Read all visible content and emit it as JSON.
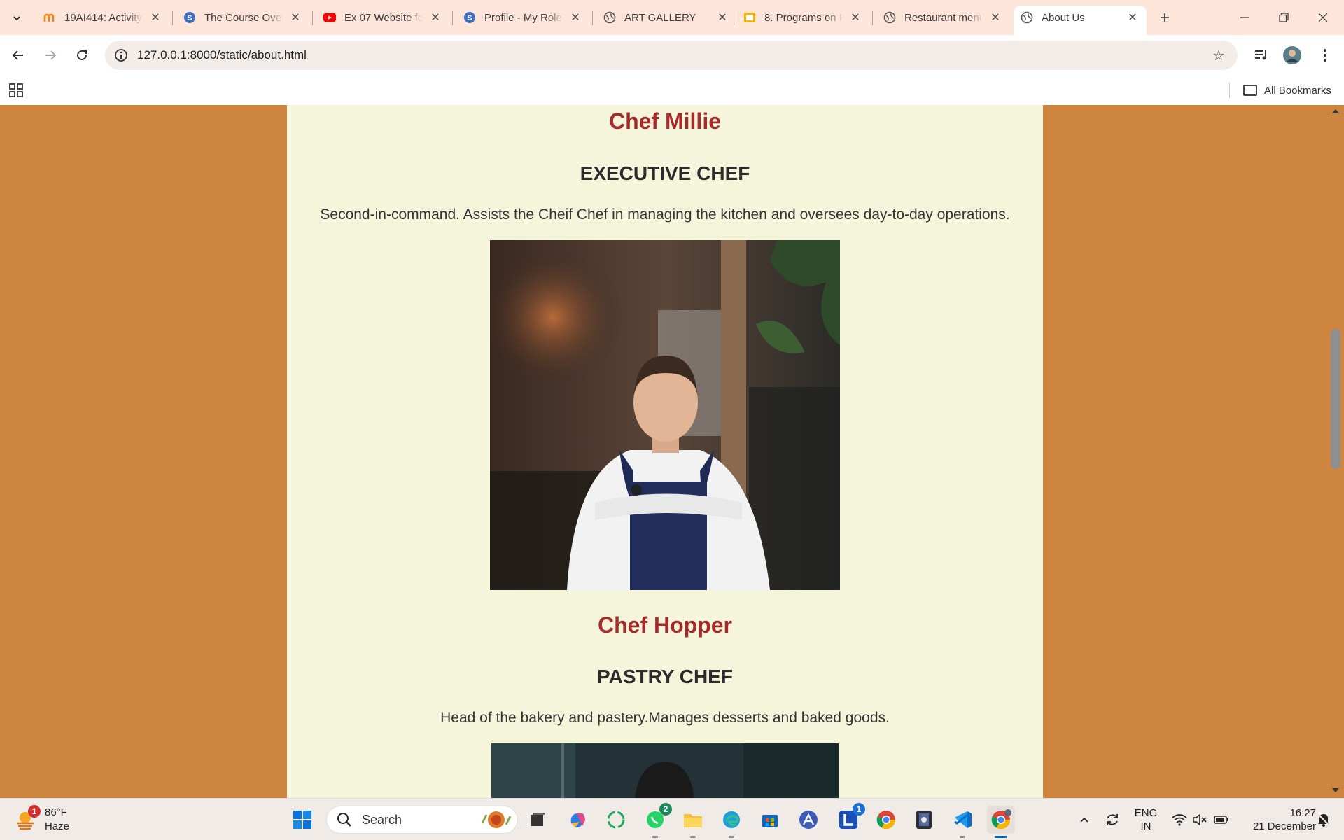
{
  "browser": {
    "tabs": [
      {
        "title": "19AI414: Activity",
        "favicon": "moodle-icon",
        "active": false
      },
      {
        "title": "The Course Over",
        "favicon": "course-icon",
        "active": false
      },
      {
        "title": "Ex 07 Website fo",
        "favicon": "youtube-icon",
        "active": false
      },
      {
        "title": "Profile - My Role",
        "favicon": "profile-icon",
        "active": false
      },
      {
        "title": "ART GALLERY",
        "favicon": "globe-icon",
        "active": false
      },
      {
        "title": "8. Programs on F",
        "favicon": "slides-icon",
        "active": false
      },
      {
        "title": "Restaurant menu",
        "favicon": "globe-icon",
        "active": false
      },
      {
        "title": "About Us",
        "favicon": "globe-icon",
        "active": true
      }
    ],
    "url": "127.0.0.1:8000/static/about.html",
    "bookmarks_all_label": "All Bookmarks"
  },
  "page": {
    "chefs": [
      {
        "name": "Chef Millie",
        "role": "EXECUTIVE CHEF",
        "description": "Second-in-command. Assists the Cheif Chef in managing the kitchen and oversees day-to-day operations."
      },
      {
        "name": "Chef Hopper",
        "role": "PASTRY CHEF",
        "description": "Head of the bakery and pastery.Manages desserts and baked goods."
      }
    ]
  },
  "taskbar": {
    "weather_temp": "86°F",
    "weather_cond": "Haze",
    "weather_badge": "1",
    "search_label": "Search",
    "whatsapp_badge": "2",
    "l_app_badge": "1",
    "lang_top": "ENG",
    "lang_bottom": "IN",
    "time": "16:27",
    "date": "21 December"
  },
  "colors": {
    "page_background": "#cd853f",
    "content_background": "#f5f5dc",
    "chef_name": "#a52a2a"
  }
}
